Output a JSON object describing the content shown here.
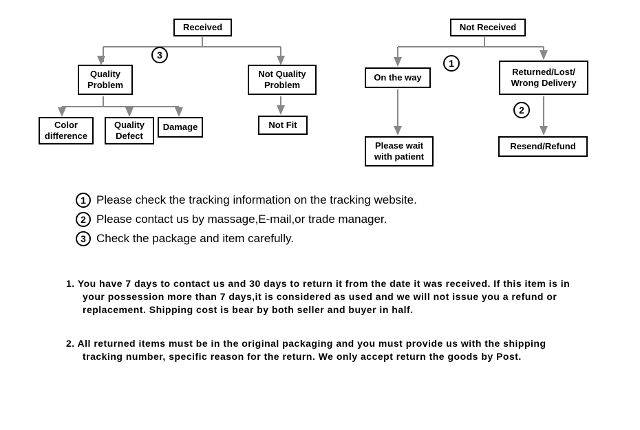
{
  "diagram": {
    "received": {
      "root": "Received",
      "quality": "Quality Problem",
      "not_quality": "Not Quality Problem",
      "color_diff": "Color difference",
      "quality_defect": "Quality Defect",
      "damage": "Damage",
      "not_fit": "Not Fit",
      "badge": "3"
    },
    "not_received": {
      "root": "Not  Received",
      "on_way": "On the way",
      "returned": "Returned/Lost/ Wrong Delivery",
      "wait": "Please wait with patient",
      "resend": "Resend/Refund",
      "badge1": "1",
      "badge2": "2"
    }
  },
  "notes": {
    "n1": {
      "num": "1",
      "text": "Please check the tracking information on the tracking website."
    },
    "n2": {
      "num": "2",
      "text": "Please contact us by  massage,E-mail,or trade manager."
    },
    "n3": {
      "num": "3",
      "text": "Check the package and item carefully."
    }
  },
  "policy": {
    "p1": "1. You have 7 days to contact us and 30 days to return it from the date it was received. If this item is in your possession more than 7 days,it is considered as used and we will not issue you a refund or replacement. Shipping cost is bear by both seller and buyer in half.",
    "p2": "2. All returned items must be in the original packaging and you must provide us with the shipping tracking number, specific reason for the return. We only accept return the goods by Post."
  }
}
